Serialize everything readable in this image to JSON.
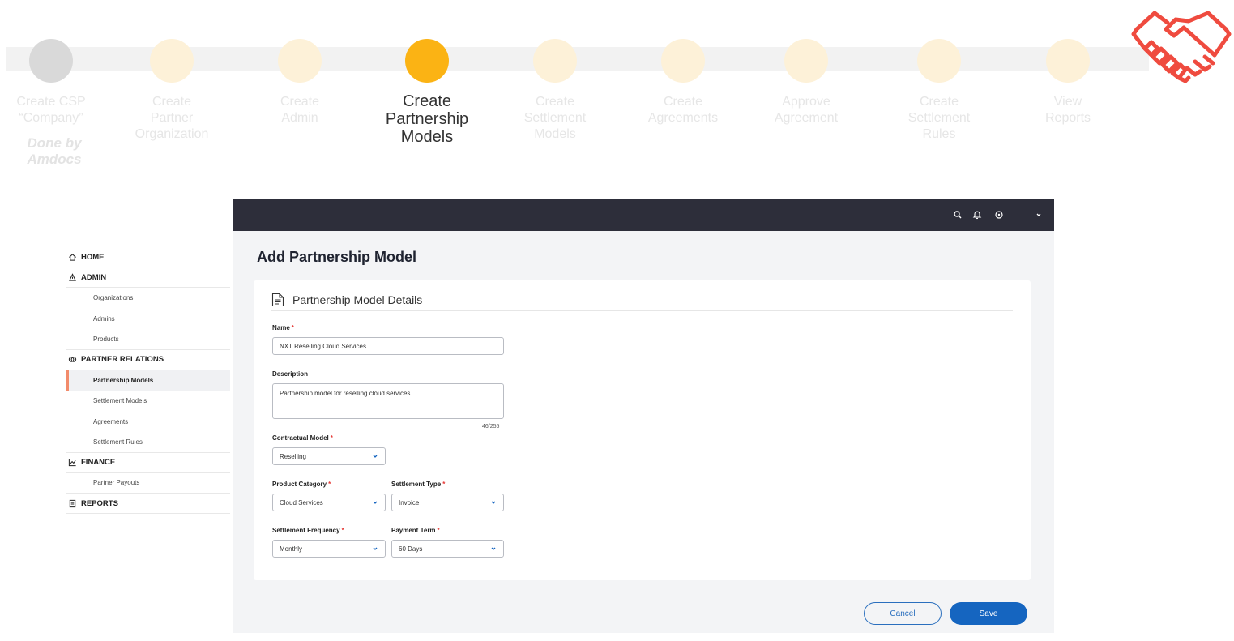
{
  "steps": [
    {
      "label": "Create CSP\n“Company”",
      "state": "done"
    },
    {
      "label": "Create\nPartner\nOrganization",
      "state": "pending"
    },
    {
      "label": "Create\nAdmin",
      "state": "pending"
    },
    {
      "label": "Create\nPartnership\nModels",
      "state": "active"
    },
    {
      "label": "Create\nSettlement\nModels",
      "state": "pending"
    },
    {
      "label": "Create\nAgreements",
      "state": "pending"
    },
    {
      "label": "Approve\nAgreement",
      "state": "pending"
    },
    {
      "label": "Create\nSettlement\nRules",
      "state": "pending"
    },
    {
      "label": "View\nReports",
      "state": "pending"
    }
  ],
  "done_note": "Done by\nAmdocs",
  "topbar": {
    "icons": [
      "search-icon",
      "bell-icon",
      "help-icon",
      "chevron-down-icon"
    ]
  },
  "sidebar": {
    "home": "HOME",
    "admin": "ADMIN",
    "admin_items": [
      "Organizations",
      "Admins",
      "Products"
    ],
    "partner_relations": "PARTNER RELATIONS",
    "partner_items": [
      "Partnership Models",
      "Settlement Models",
      "Agreements",
      "Settlement Rules"
    ],
    "finance": "FINANCE",
    "finance_items": [
      "Partner Payouts"
    ],
    "reports": "REPORTS"
  },
  "page": {
    "title": "Add Partnership Model",
    "card_title": "Partnership Model Details"
  },
  "form": {
    "name_label": "Name",
    "name_value": "NXT Reselling Cloud Services",
    "description_label": "Description",
    "description_value": "Partnership model for reselling cloud services",
    "description_counter": "46/255",
    "contractual_label": "Contractual Model",
    "contractual_value": "Reselling",
    "product_category_label": "Product Category",
    "product_category_value": "Cloud Services",
    "settlement_type_label": "Settlement Type",
    "settlement_type_value": "Invoice",
    "settlement_frequency_label": "Settlement Frequency",
    "settlement_frequency_value": "Monthly",
    "payment_term_label": "Payment Term",
    "payment_term_value": "60 Days",
    "required_mark": "*"
  },
  "buttons": {
    "cancel": "Cancel",
    "save": "Save"
  },
  "colors": {
    "accent": "#fbb314",
    "brand_blue": "#1565c0",
    "topbar": "#2d2e3a",
    "handshake": "#ef4b3f"
  }
}
